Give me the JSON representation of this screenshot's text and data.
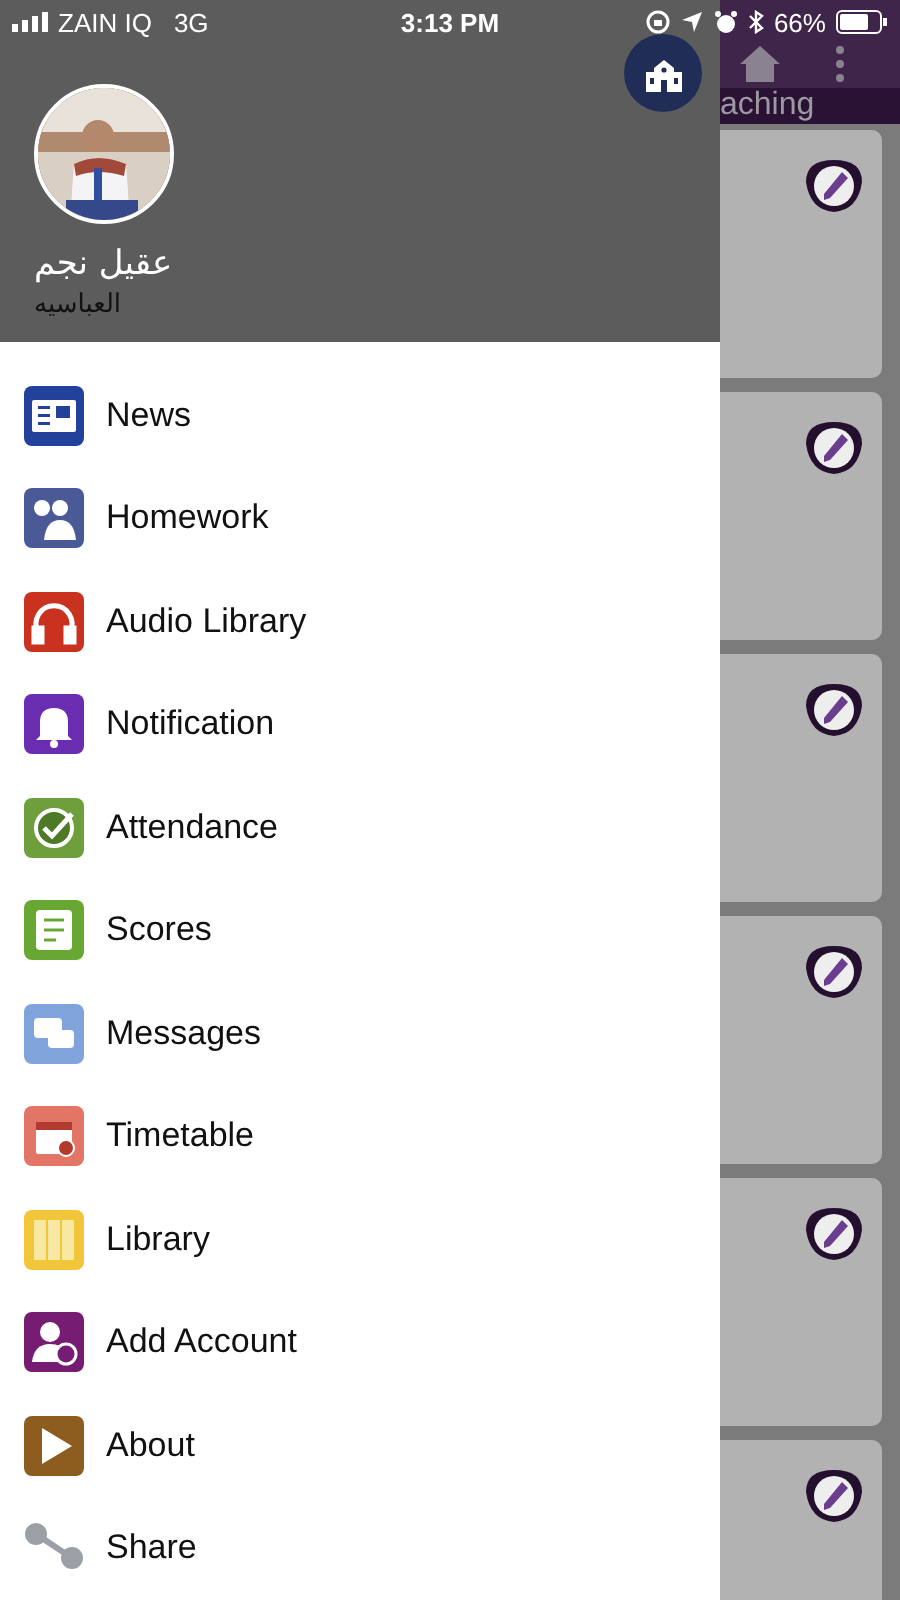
{
  "status_bar": {
    "carrier": "ZAIN IQ",
    "network": "3G",
    "time": "3:13 PM",
    "battery": "66%"
  },
  "drawer": {
    "profile": {
      "name": "عقيل نجم",
      "subtitle": "العباسيه"
    },
    "items": [
      {
        "label": "News",
        "kind": "news",
        "color": "#22419a"
      },
      {
        "label": "Homework",
        "kind": "homework",
        "color": "#4a5a96"
      },
      {
        "label": "Audio Library",
        "kind": "audio",
        "color": "#c8321f"
      },
      {
        "label": "Notification",
        "kind": "bell",
        "color": "#6a2cb0"
      },
      {
        "label": "Attendance",
        "kind": "clock",
        "color": "#6f9e3c"
      },
      {
        "label": "Scores",
        "kind": "scores",
        "color": "#68a832"
      },
      {
        "label": "Messages",
        "kind": "chat",
        "color": "#7fa3da"
      },
      {
        "label": "Timetable",
        "kind": "calendar",
        "color": "#e27566"
      },
      {
        "label": "Library",
        "kind": "books",
        "color": "#f2c53a"
      },
      {
        "label": "Add Account",
        "kind": "adduser",
        "color": "#761c72"
      },
      {
        "label": "About",
        "kind": "play",
        "color": "#8c5d1f"
      },
      {
        "label": "Share",
        "kind": "share",
        "color": "#9aa0a6"
      }
    ]
  },
  "app": {
    "tab_label": "aching"
  }
}
